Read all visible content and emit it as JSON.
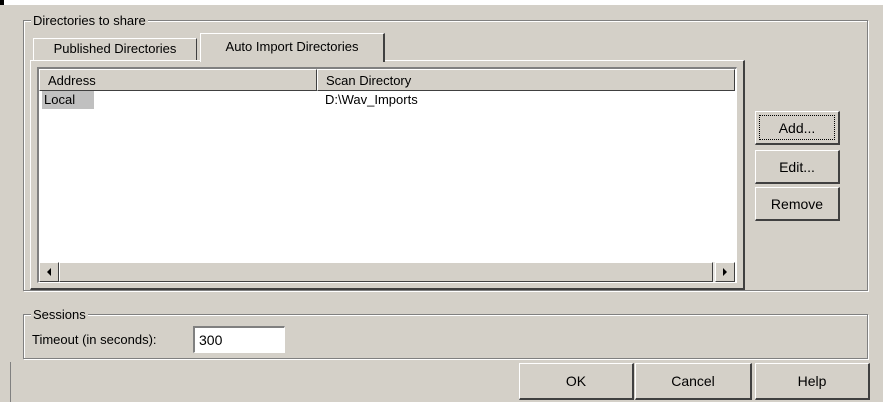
{
  "directories": {
    "legend": "Directories to share",
    "tabs": [
      {
        "label": "Published Directories",
        "active": false
      },
      {
        "label": "Auto Import Directories",
        "active": true
      }
    ],
    "columns": [
      "Address",
      "Scan Directory"
    ],
    "rows": [
      {
        "address": "Local",
        "scan_directory": "D:\\Wav_Imports"
      }
    ],
    "buttons": {
      "add": "Add...",
      "edit": "Edit...",
      "remove": "Remove"
    }
  },
  "sessions": {
    "legend": "Sessions",
    "timeout_label": "Timeout (in seconds):",
    "timeout_value": "300"
  },
  "footer": {
    "ok": "OK",
    "cancel": "Cancel",
    "help": "Help"
  },
  "icons": {
    "scroll_left": "arrow-left-icon",
    "scroll_right": "arrow-right-icon"
  }
}
